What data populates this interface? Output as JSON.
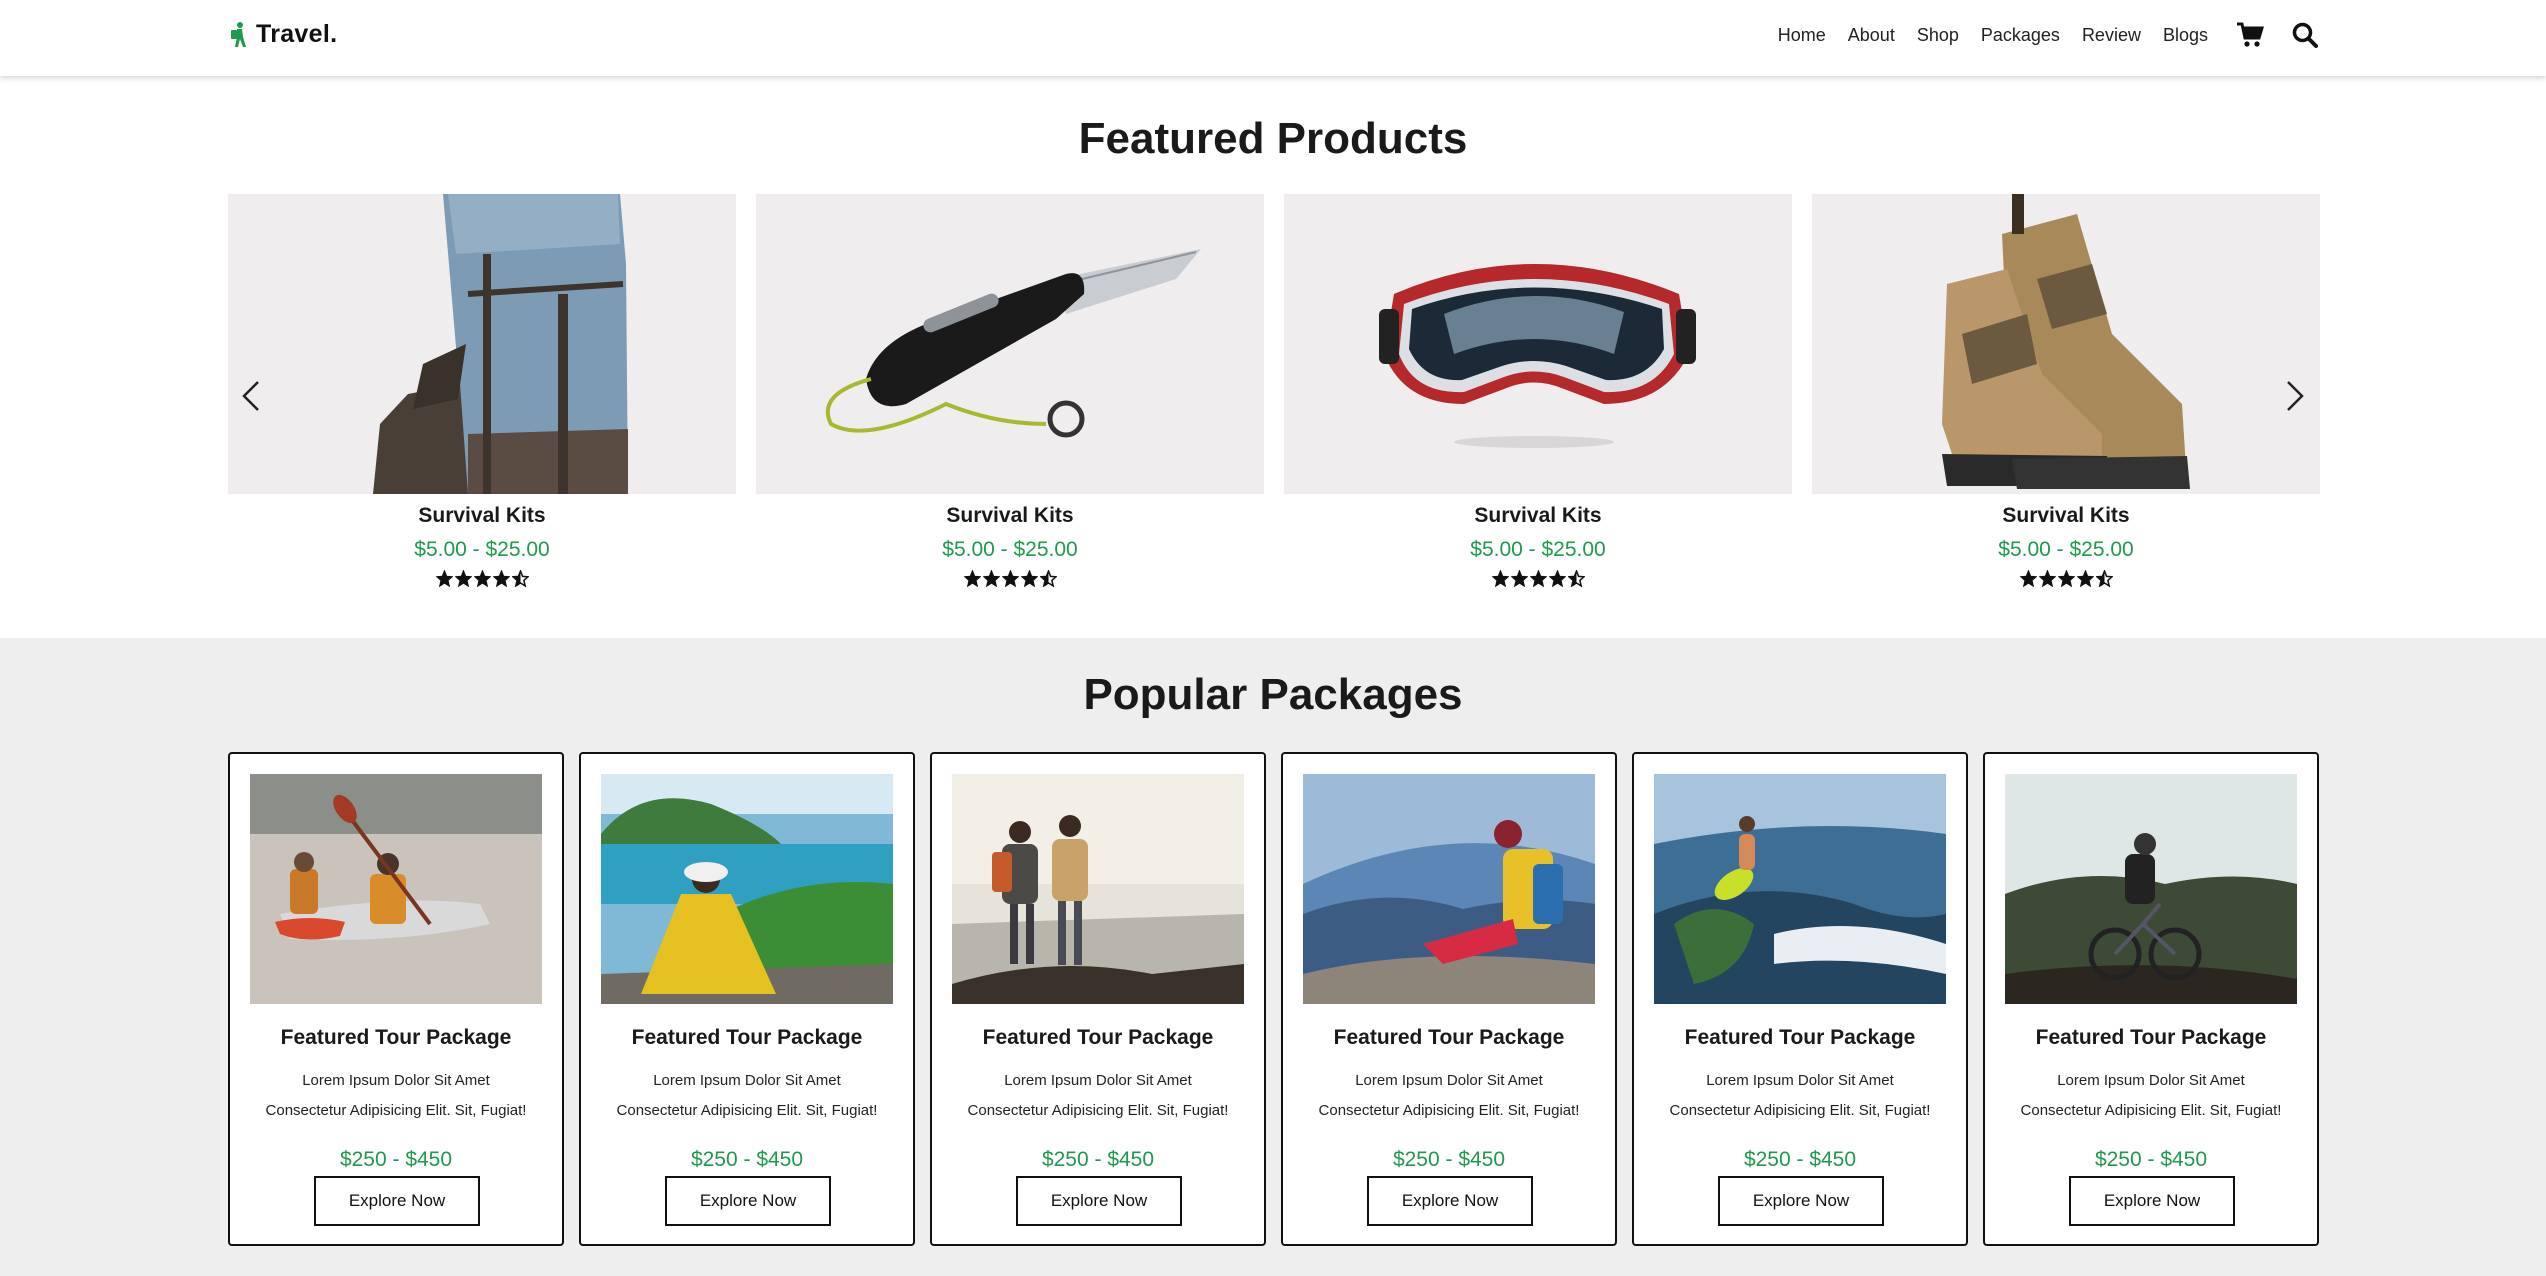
{
  "header": {
    "logo_text": "Travel.",
    "nav": [
      "Home",
      "About",
      "Shop",
      "Packages",
      "Review",
      "Blogs"
    ],
    "icons": [
      "cart-icon",
      "search-icon"
    ]
  },
  "featured": {
    "title": "Featured Products",
    "products": [
      {
        "name": "Survival Kits",
        "price": "$5.00 - $25.00",
        "rating": 4.5,
        "image": "backpack"
      },
      {
        "name": "Survival Kits",
        "price": "$5.00 - $25.00",
        "rating": 4.5,
        "image": "knife"
      },
      {
        "name": "Survival Kits",
        "price": "$5.00 - $25.00",
        "rating": 4.5,
        "image": "goggles"
      },
      {
        "name": "Survival Kits",
        "price": "$5.00 - $25.00",
        "rating": 4.5,
        "image": "boots"
      }
    ]
  },
  "packages": {
    "title": "Popular Packages",
    "items": [
      {
        "title": "Featured Tour Package",
        "desc1": "Lorem Ipsum Dolor Sit Amet",
        "desc2": "Consectetur Adipisicing Elit. Sit, Fugiat!",
        "price": "$250 - $450",
        "button": "Explore Now"
      },
      {
        "title": "Featured Tour Package",
        "desc1": "Lorem Ipsum Dolor Sit Amet",
        "desc2": "Consectetur Adipisicing Elit. Sit, Fugiat!",
        "price": "$250 - $450",
        "button": "Explore Now"
      },
      {
        "title": "Featured Tour Package",
        "desc1": "Lorem Ipsum Dolor Sit Amet",
        "desc2": "Consectetur Adipisicing Elit. Sit, Fugiat!",
        "price": "$250 - $450",
        "button": "Explore Now"
      },
      {
        "title": "Featured Tour Package",
        "desc1": "Lorem Ipsum Dolor Sit Amet",
        "desc2": "Consectetur Adipisicing Elit. Sit, Fugiat!",
        "price": "$250 - $450",
        "button": "Explore Now"
      },
      {
        "title": "Featured Tour Package",
        "desc1": "Lorem Ipsum Dolor Sit Amet",
        "desc2": "Consectetur Adipisicing Elit. Sit, Fugiat!",
        "price": "$250 - $450",
        "button": "Explore Now"
      },
      {
        "title": "Featured Tour Package",
        "desc1": "Lorem Ipsum Dolor Sit Amet",
        "desc2": "Consectetur Adipisicing Elit. Sit, Fugiat!",
        "price": "$250 - $450",
        "button": "Explore Now"
      }
    ]
  },
  "colors": {
    "accent_green": "#1e9a4e",
    "section_bg": "#eeeeee",
    "product_bg": "#efedee"
  }
}
